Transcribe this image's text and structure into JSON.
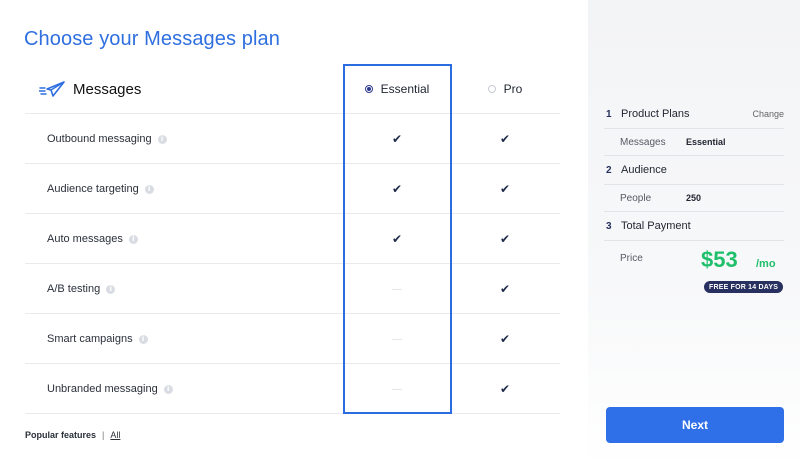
{
  "page": {
    "title": "Choose your Messages plan"
  },
  "product": {
    "name": "Messages",
    "icon": "paper-plane-icon"
  },
  "plans": {
    "essential": {
      "label": "Essential",
      "selected": true
    },
    "pro": {
      "label": "Pro",
      "selected": false
    }
  },
  "features": [
    {
      "label": "Outbound messaging",
      "essential": "✔",
      "pro": "✔"
    },
    {
      "label": "Audience targeting",
      "essential": "✔",
      "pro": "✔"
    },
    {
      "label": "Auto messages",
      "essential": "✔",
      "pro": "✔"
    },
    {
      "label": "A/B testing",
      "essential": "—",
      "pro": "✔"
    },
    {
      "label": "Smart campaigns",
      "essential": "—",
      "pro": "✔"
    },
    {
      "label": "Unbranded messaging",
      "essential": "—",
      "pro": "✔"
    }
  ],
  "info_icon": "i",
  "footer": {
    "popular": "Popular features",
    "separator": "|",
    "all": "All"
  },
  "summary": {
    "steps": [
      {
        "num": "1",
        "title": "Product Plans",
        "action": "Change",
        "detail_label": "Messages",
        "detail_value": "Essential"
      },
      {
        "num": "2",
        "title": "Audience",
        "detail_label": "People",
        "detail_value": "250"
      },
      {
        "num": "3",
        "title": "Total Payment",
        "price_label": "Price",
        "price": "$53",
        "unit": "/mo",
        "badge": "FREE FOR 14 DAYS"
      }
    ]
  },
  "next_button": {
    "label": "Next"
  },
  "colors": {
    "accent": "#2f6fe8",
    "price": "#1fbf6b",
    "navy": "#27305e"
  }
}
